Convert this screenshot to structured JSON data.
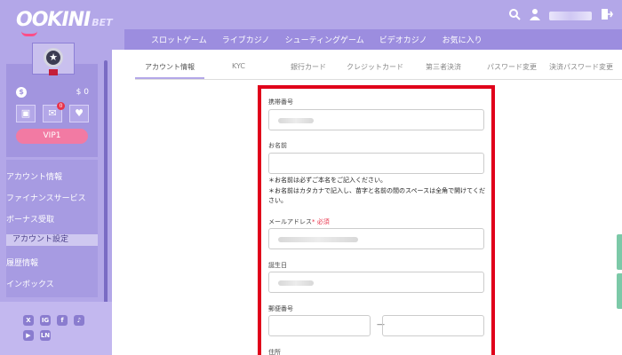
{
  "logo": {
    "main": "OOKINI",
    "suffix": "BET"
  },
  "header": {
    "nav": [
      "スロットゲーム",
      "ライブカジノ",
      "シューティングゲーム",
      "ビデオカジノ",
      "お気に入り"
    ],
    "search_icon": "search-icon",
    "user_icon": "user-icon",
    "logout_icon": "logout-icon"
  },
  "sidebar": {
    "balance": "$ 0",
    "coin_symbol": "$",
    "mail_badge": "0",
    "vip": "VIP1",
    "menu": [
      "アカウント情報",
      "ファイナンスサービス",
      "ボーナス受取",
      "アカウント設定",
      "履歴情報",
      "インボックス"
    ],
    "social": [
      "X",
      "IG",
      "f",
      "♪",
      "▶",
      "LN"
    ]
  },
  "tabs": [
    "アカウント情報",
    "KYC",
    "銀行カード",
    "クレジットカード",
    "第三者決済",
    "パスワード変更",
    "決済パスワード変更"
  ],
  "form": {
    "phone_label": "携帯番号",
    "name_label": "お名前",
    "name_note1": "＊お名前は必ずご本名をご記入ください。",
    "name_note2": "＊お名前はカタカナで記入し、苗字と名前の間のスペースは全角で開けてください。",
    "email_label": "メールアドレス",
    "required_mark": "* 必須",
    "birthday_label": "誕生日",
    "zip_label": "郵便番号",
    "zip_separator": "—",
    "address_label": "住所"
  },
  "colors": {
    "brand": "#b3a7e8",
    "highlight": "#e0001a",
    "vip": "#f27aa3"
  }
}
